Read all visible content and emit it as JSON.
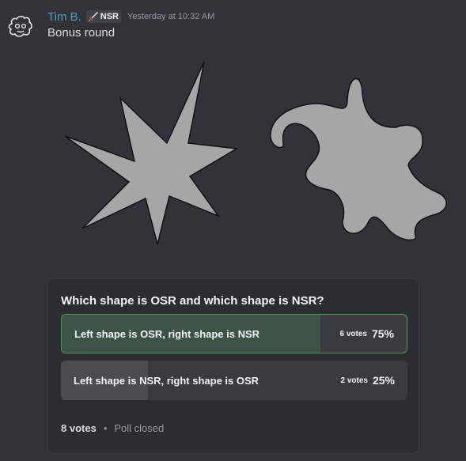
{
  "message": {
    "author": "Tim B.",
    "role_tag": "NSR",
    "role_icon": "sword-icon",
    "timestamp": "Yesterday at 10:32 AM",
    "text": "Bonus round",
    "avatar_icon": "avatar-doodle-icon"
  },
  "attachment": {
    "shapes": [
      {
        "icon": "spiky-star-shape",
        "fill": "#a6a6a6"
      },
      {
        "icon": "rounded-blob-shape",
        "fill": "#a6a6a6"
      }
    ]
  },
  "poll": {
    "question": "Which shape is OSR and which shape is NSR?",
    "options": [
      {
        "label": "Left shape is OSR, right shape is NSR",
        "votes": "6 votes",
        "percent": "75%",
        "fraction": 0.75,
        "selected": true,
        "fill_color": "#3b5446"
      },
      {
        "label": "Left shape is NSR, right shape is OSR",
        "votes": "2 votes",
        "percent": "25%",
        "fraction": 0.25,
        "selected": false,
        "fill_color": "#4a4c52"
      }
    ],
    "total_votes": "8 votes",
    "separator": "•",
    "status": "Poll closed"
  },
  "colors": {
    "background": "#313338",
    "username": "#4e9fbb",
    "poll_background": "#2b2d31",
    "selected_border": "#4f9960"
  }
}
